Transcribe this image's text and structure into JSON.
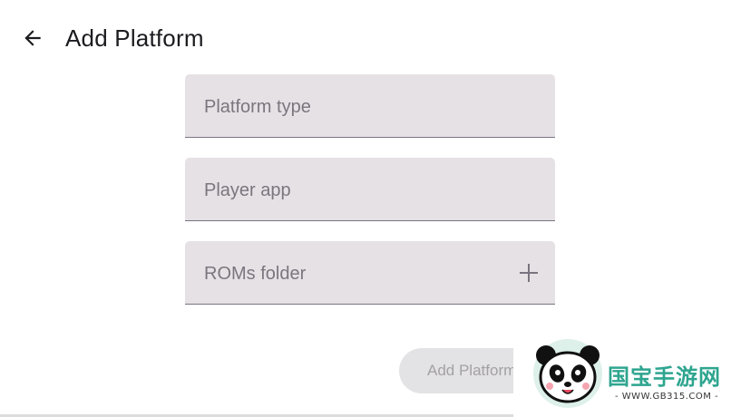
{
  "header": {
    "back_icon": "arrow-left-icon",
    "title": "Add Platform"
  },
  "form": {
    "platform_type": {
      "label": "Platform type"
    },
    "player_app": {
      "label": "Player app"
    },
    "roms_folder": {
      "label": "ROMs folder",
      "action_icon": "plus-icon"
    },
    "submit_label": "Add Platform"
  },
  "watermark": {
    "text": "国宝手游网",
    "url": "- WWW.GB315.COM -"
  },
  "colors": {
    "field_bg": "#e6e1e5",
    "label": "#7a767e",
    "title": "#1c1b1f",
    "button_disabled_bg": "#e3e2e4",
    "button_disabled_text": "#a3a1a6"
  }
}
